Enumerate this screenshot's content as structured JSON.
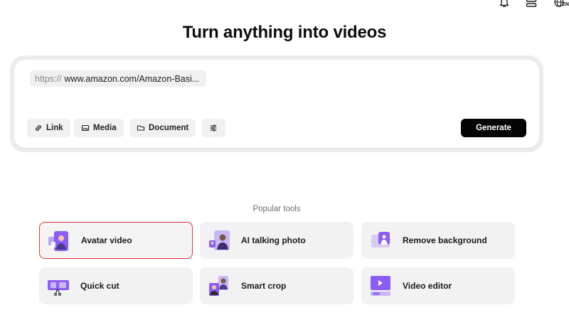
{
  "header": {
    "icons": [
      "bell-icon",
      "layers-icon",
      "globe-language-icon"
    ],
    "language_badge": "EN"
  },
  "hero": {
    "title": "Turn anything into videos"
  },
  "generator": {
    "url_prefix": "https://",
    "url_value": "www.amazon.com/Amazon-Basi...",
    "buttons": {
      "link": "Link",
      "media": "Media",
      "document": "Document"
    },
    "generate_label": "Generate"
  },
  "popular": {
    "label": "Popular tools",
    "tools": [
      {
        "label": "Avatar video",
        "icon": "avatar-video-icon",
        "selected": true
      },
      {
        "label": "AI talking photo",
        "icon": "talking-photo-icon",
        "selected": false
      },
      {
        "label": "Remove background",
        "icon": "remove-background-icon",
        "selected": false
      },
      {
        "label": "Quick cut",
        "icon": "quick-cut-icon",
        "selected": false
      },
      {
        "label": "Smart crop",
        "icon": "smart-crop-icon",
        "selected": false
      },
      {
        "label": "Video editor",
        "icon": "video-editor-icon",
        "selected": false
      }
    ]
  },
  "colors": {
    "accent_purple": "#8b5cf6",
    "generate_bg": "#050505",
    "selected_border": "#e0383e"
  }
}
